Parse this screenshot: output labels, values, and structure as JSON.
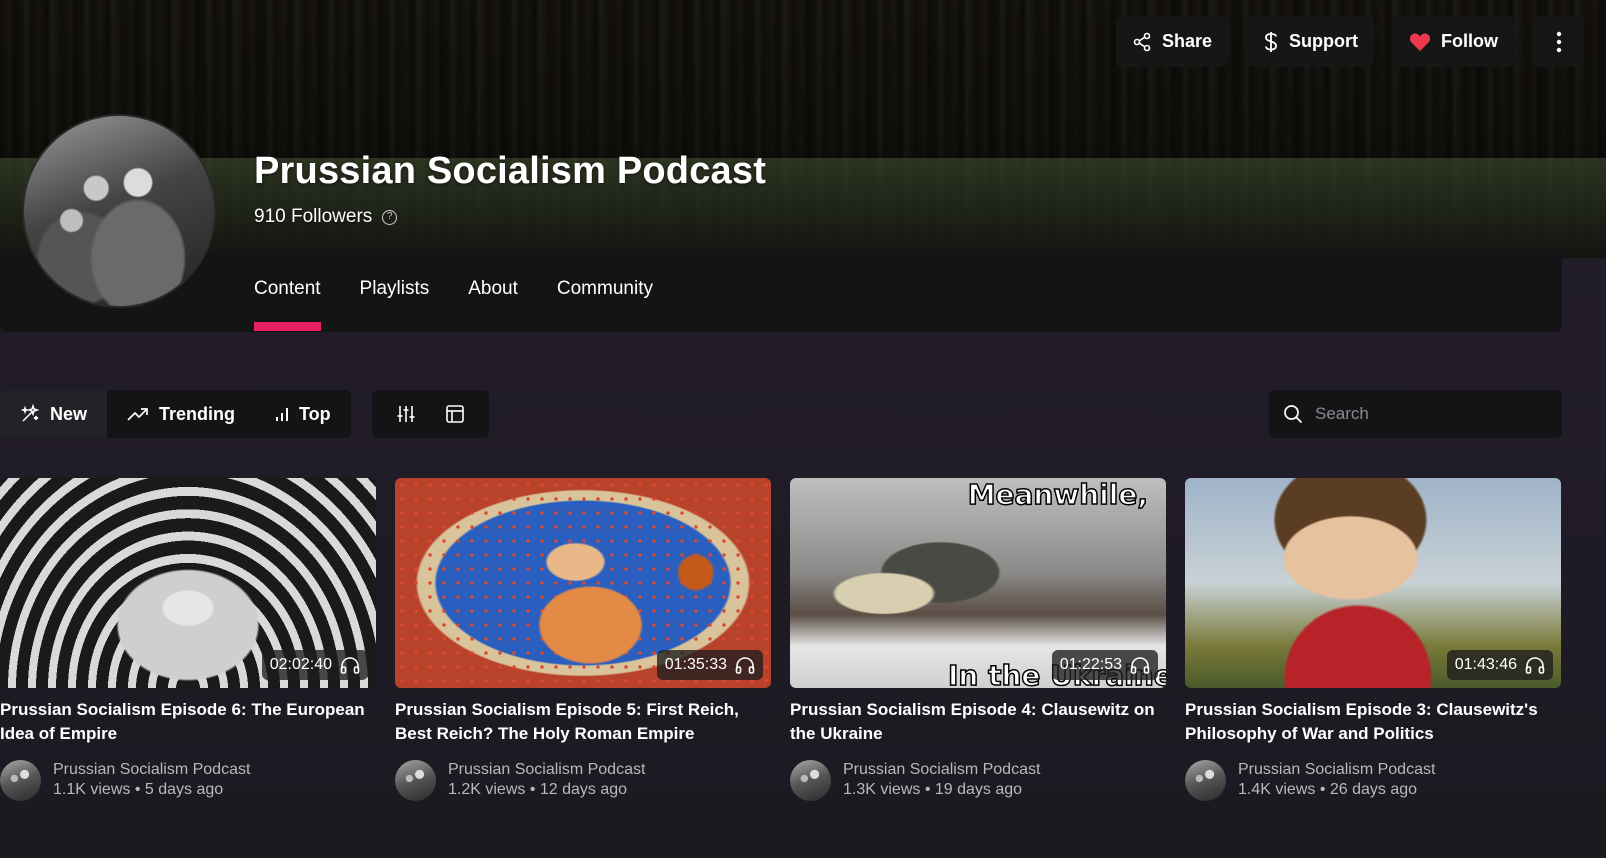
{
  "header": {
    "title": "Prussian Socialism Podcast",
    "followers": "910 Followers",
    "help_glyph": "?"
  },
  "actions": {
    "share": "Share",
    "support": "Support",
    "follow": "Follow"
  },
  "tabs": [
    {
      "label": "Content",
      "active": true
    },
    {
      "label": "Playlists",
      "active": false
    },
    {
      "label": "About",
      "active": false
    },
    {
      "label": "Community",
      "active": false
    }
  ],
  "filters": {
    "new": "New",
    "trending": "Trending",
    "top": "Top",
    "active": "New"
  },
  "search": {
    "placeholder": "Search",
    "value": ""
  },
  "cards": [
    {
      "duration": "02:02:40",
      "title": "Prussian Socialism Episode 6: The European Idea of Empire",
      "channel": "Prussian Socialism Podcast",
      "stats": "1.1K views • 5 days ago"
    },
    {
      "duration": "01:35:33",
      "title": "Prussian Socialism Episode 5: First Reich, Best Reich? The Holy Roman Empire",
      "channel": "Prussian Socialism Podcast",
      "stats": "1.2K views • 12 days ago"
    },
    {
      "duration": "01:22:53",
      "title": "Prussian Socialism Episode 4: Clausewitz on the Ukraine",
      "channel": "Prussian Socialism Podcast",
      "stats": "1.3K views • 19 days ago",
      "thumb_text_top": "Meanwhile,",
      "thumb_text_bottom": "In the Ukraine..."
    },
    {
      "duration": "01:43:46",
      "title": "Prussian Socialism Episode 3: Clausewitz's Philosophy of War and Politics",
      "channel": "Prussian Socialism Podcast",
      "stats": "1.4K views • 26 days ago"
    }
  ],
  "colors": {
    "accent": "#e91e63",
    "heart": "#f0394f",
    "panel": "#141316",
    "background": "#1c1a21"
  },
  "icons": {
    "share": "share-icon",
    "support": "dollar-icon",
    "follow": "heart-icon",
    "more": "more-vertical-icon",
    "new": "sparkle-icon",
    "trending": "trending-up-icon",
    "top": "bar-chart-icon",
    "filter": "sliders-icon",
    "layout": "layout-icon",
    "search": "search-icon",
    "listen": "headphones-icon"
  }
}
